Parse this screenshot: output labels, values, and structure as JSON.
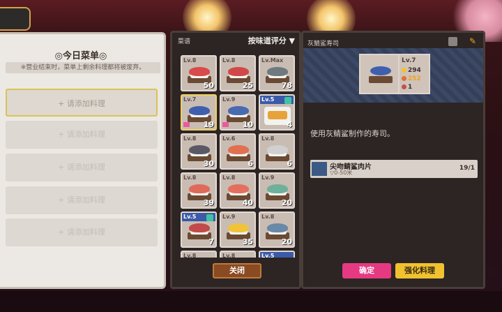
{
  "left_menu": {
    "title": "◎今日菜单◎",
    "notice": "※营业结束时，菜单上剩余料理都将被废弃。",
    "slots": [
      "+ 请添加料理",
      "+ 请添加料理",
      "+ 请添加料理",
      "+ 请添加料理",
      "+ 请添加料理"
    ]
  },
  "recipe_panel": {
    "title": "菜谱",
    "sort_label": "按味道评分",
    "sort_icon": "triangle-down-icon",
    "close_label": "关闭",
    "tiles": [
      {
        "level": "Lv.8",
        "count": "50",
        "fish_color": "#d94a4a"
      },
      {
        "level": "Lv.8",
        "count": "25",
        "fish_color": "#d24848"
      },
      {
        "level": "Lv.Max",
        "count": "78",
        "fish_color": "#6e7a80"
      },
      {
        "level": "Lv.7",
        "count": "19",
        "fish_color": "#3f5fae",
        "ribbon": true,
        "selected": true
      },
      {
        "level": "Lv.9",
        "count": "10",
        "fish_color": "#4a6ab0",
        "ribbon": true
      },
      {
        "level": "Lv.5",
        "count": "4",
        "fish_color": "#e8a23a",
        "check": true,
        "bar": true,
        "plate": true
      },
      {
        "level": "Lv.8",
        "count": "30",
        "fish_color": "#5a5a66"
      },
      {
        "level": "Lv.6",
        "count": "6",
        "fish_color": "#e07050"
      },
      {
        "level": "Lv.8",
        "count": "6",
        "fish_color": "#d0d0d0"
      },
      {
        "level": "Lv.8",
        "count": "39",
        "fish_color": "#e06a5a"
      },
      {
        "level": "Lv.8",
        "count": "40",
        "fish_color": "#e3705e"
      },
      {
        "level": "Lv.9",
        "count": "20",
        "fish_color": "#6fb09a"
      },
      {
        "level": "Lv.5",
        "count": "7",
        "fish_color": "#c24a4a",
        "check": true,
        "bar": true
      },
      {
        "level": "Lv.9",
        "count": "35",
        "fish_color": "#f0c33a"
      },
      {
        "level": "Lv.8",
        "count": "20",
        "fish_color": "#6a88a8"
      },
      {
        "level": "Lv.8",
        "count": "",
        "fish_color": "#cccccc"
      },
      {
        "level": "Lv.8",
        "count": "",
        "fish_color": "#cccccc"
      },
      {
        "level": "Lv.5",
        "count": "",
        "fish_color": "#cccccc",
        "bar": true
      }
    ]
  },
  "detail_panel": {
    "title": "灰鲭鲨寿司",
    "level": "Lv.7",
    "stats": {
      "coins": "294",
      "taste": "252",
      "count": "1"
    },
    "colors": {
      "coins": "#f0c230",
      "taste": "#f0a020",
      "count": "#c05050",
      "accent": "#3f5fae"
    },
    "description": "使用灰鲭鲨制作的寿司。",
    "ingredient": {
      "name": "尖吻鲭鲨肉片",
      "location": "▽0-50米",
      "count": "19/1"
    },
    "confirm_label": "确定",
    "upgrade_label": "强化料理",
    "icons": [
      "mail-icon",
      "pin-icon"
    ]
  }
}
